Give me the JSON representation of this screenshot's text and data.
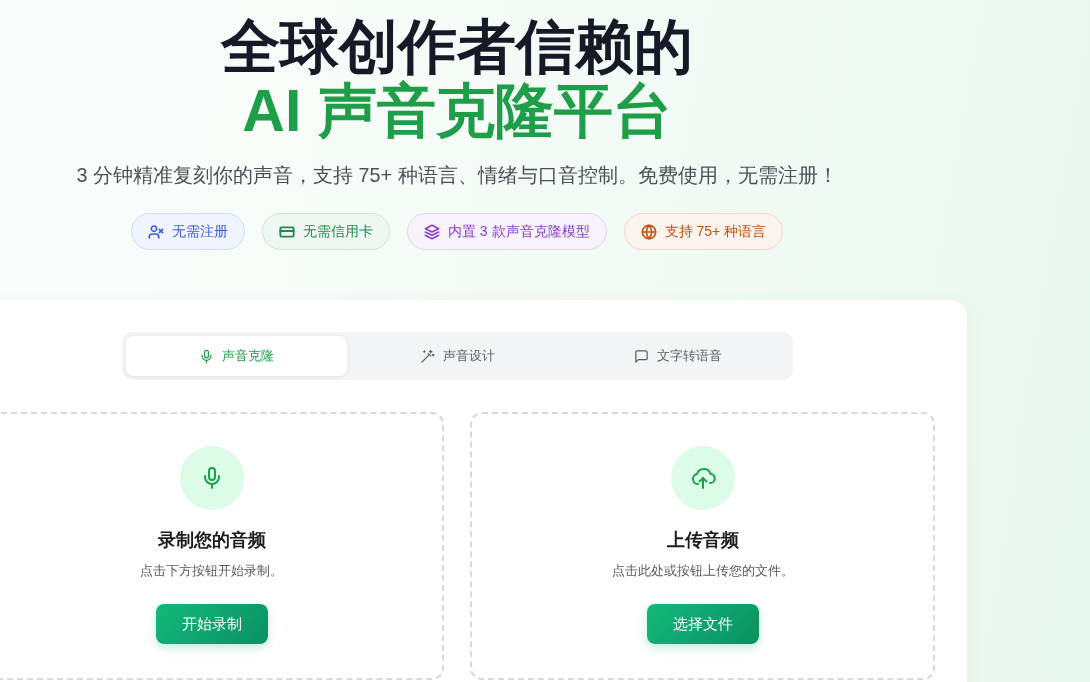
{
  "hero": {
    "title_line_1": "全球创作者信赖的",
    "title_line_2": "AI 声音克隆平台",
    "subtitle": "3 分钟精准复刻你的声音，支持 75+ 种语言、情绪与口音控制。免费使用，无需注册！"
  },
  "badges": [
    {
      "label": "无需注册",
      "color": "#3b5bdb"
    },
    {
      "label": "无需信用卡",
      "color": "#1f8a4c"
    },
    {
      "label": "内置 3 款声音克隆模型",
      "color": "#8a3fc7"
    },
    {
      "label": "支持 75+ 种语言",
      "color": "#c2500f"
    }
  ],
  "tabs": [
    {
      "label": "声音克隆",
      "selected": true
    },
    {
      "label": "声音设计",
      "selected": false
    },
    {
      "label": "文字转语音",
      "selected": false
    }
  ],
  "panels": [
    {
      "title": "录制您的音频",
      "description": "点击下方按钮开始录制。",
      "button": "开始录制"
    },
    {
      "title": "上传音频",
      "description": "点击此处或按钮上传您的文件。",
      "button": "选择文件"
    }
  ]
}
